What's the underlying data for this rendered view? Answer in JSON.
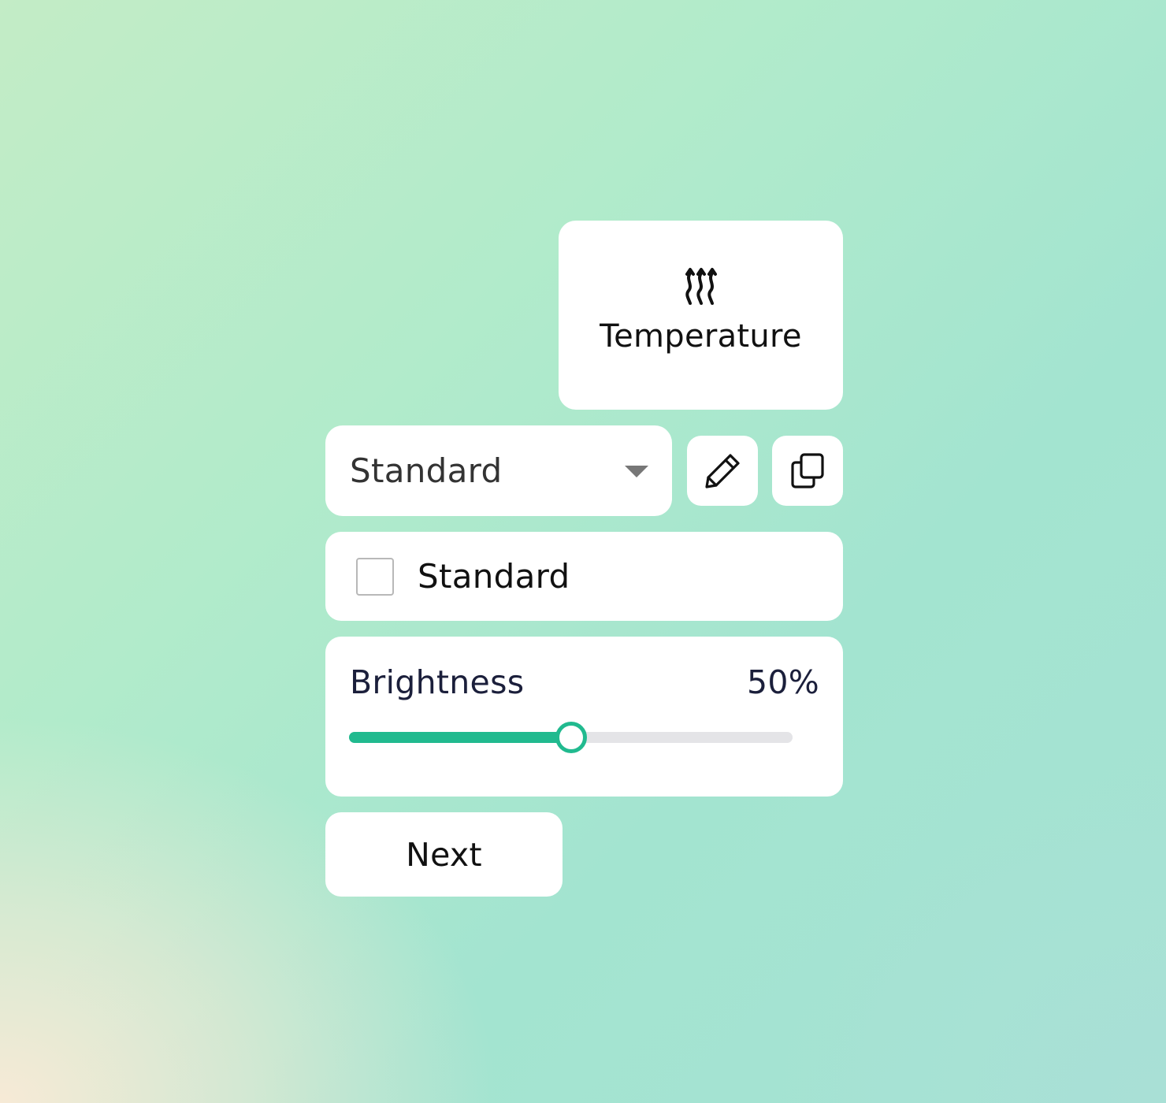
{
  "temperature_tile": {
    "label": "Temperature",
    "icon": "heat-waves-icon"
  },
  "preset_dropdown": {
    "selected": "Standard",
    "icon": "caret-down-icon"
  },
  "edit_button": {
    "icon": "pencil-icon"
  },
  "copy_button": {
    "icon": "copy-icon"
  },
  "standard_checkbox": {
    "label": "Standard",
    "checked": false
  },
  "brightness": {
    "label": "Brightness",
    "value_text": "50%",
    "value": 0.5,
    "accent_color": "#21ba8f",
    "track_color": "#e4e4e7"
  },
  "next_button": {
    "label": "Next"
  }
}
